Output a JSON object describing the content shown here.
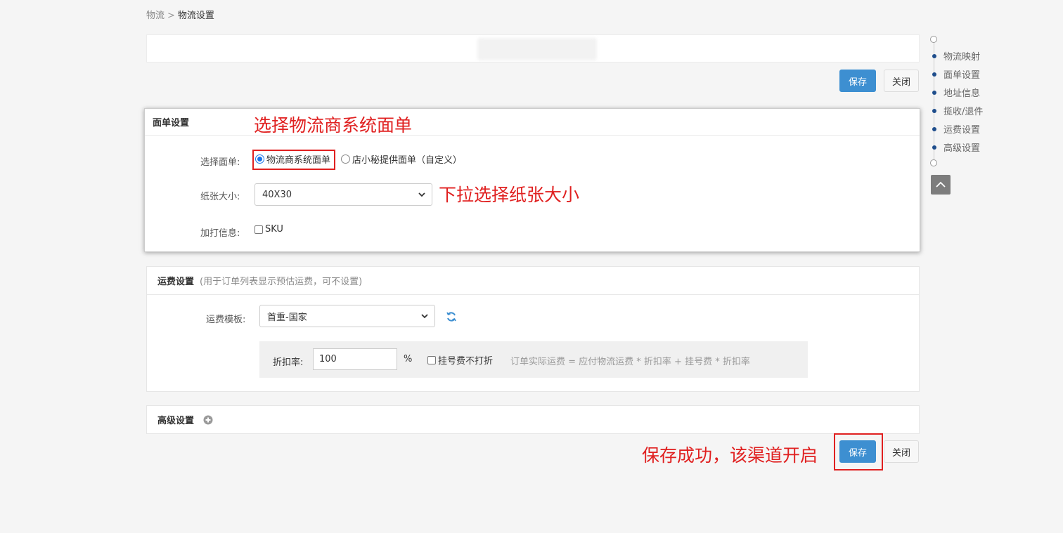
{
  "breadcrumb": {
    "parent": "物流",
    "separator": ">",
    "current": "物流设置"
  },
  "toolbar": {
    "save_label": "保存",
    "close_label": "关闭"
  },
  "waybill": {
    "title": "面单设置",
    "select_label": "选择面单:",
    "option_carrier": "物流商系统面单",
    "option_custom": "店小秘提供面单（自定义）",
    "selected": "option_carrier",
    "paper_label": "纸张大小:",
    "paper_value": "40X30",
    "extra_label": "加打信息:",
    "extra_sku": "SKU"
  },
  "freight": {
    "title": "运费设置",
    "note": "(用于订单列表显示预估运费，可不设置)",
    "template_label": "运费模板:",
    "template_value": "首重-国家",
    "discount_label": "折扣率:",
    "discount_value": "100",
    "discount_unit": "%",
    "registered_label": "挂号费不打折",
    "formula": "订单实际运费 = 应付物流运费 * 折扣率 + 挂号费 * 折扣率"
  },
  "advanced": {
    "title": "高级设置"
  },
  "side_nav": {
    "items": [
      "物流映射",
      "面单设置",
      "地址信息",
      "揽收/退件",
      "运费设置",
      "高级设置"
    ]
  },
  "annotations": {
    "select_waybill": "选择物流商系统面单",
    "select_paper": "下拉选择纸张大小",
    "save_success": "保存成功，该渠道开启"
  },
  "colors": {
    "primary": "#3d8fd1",
    "annotation": "#e02020",
    "nav_bullet": "#1f4e8c"
  }
}
